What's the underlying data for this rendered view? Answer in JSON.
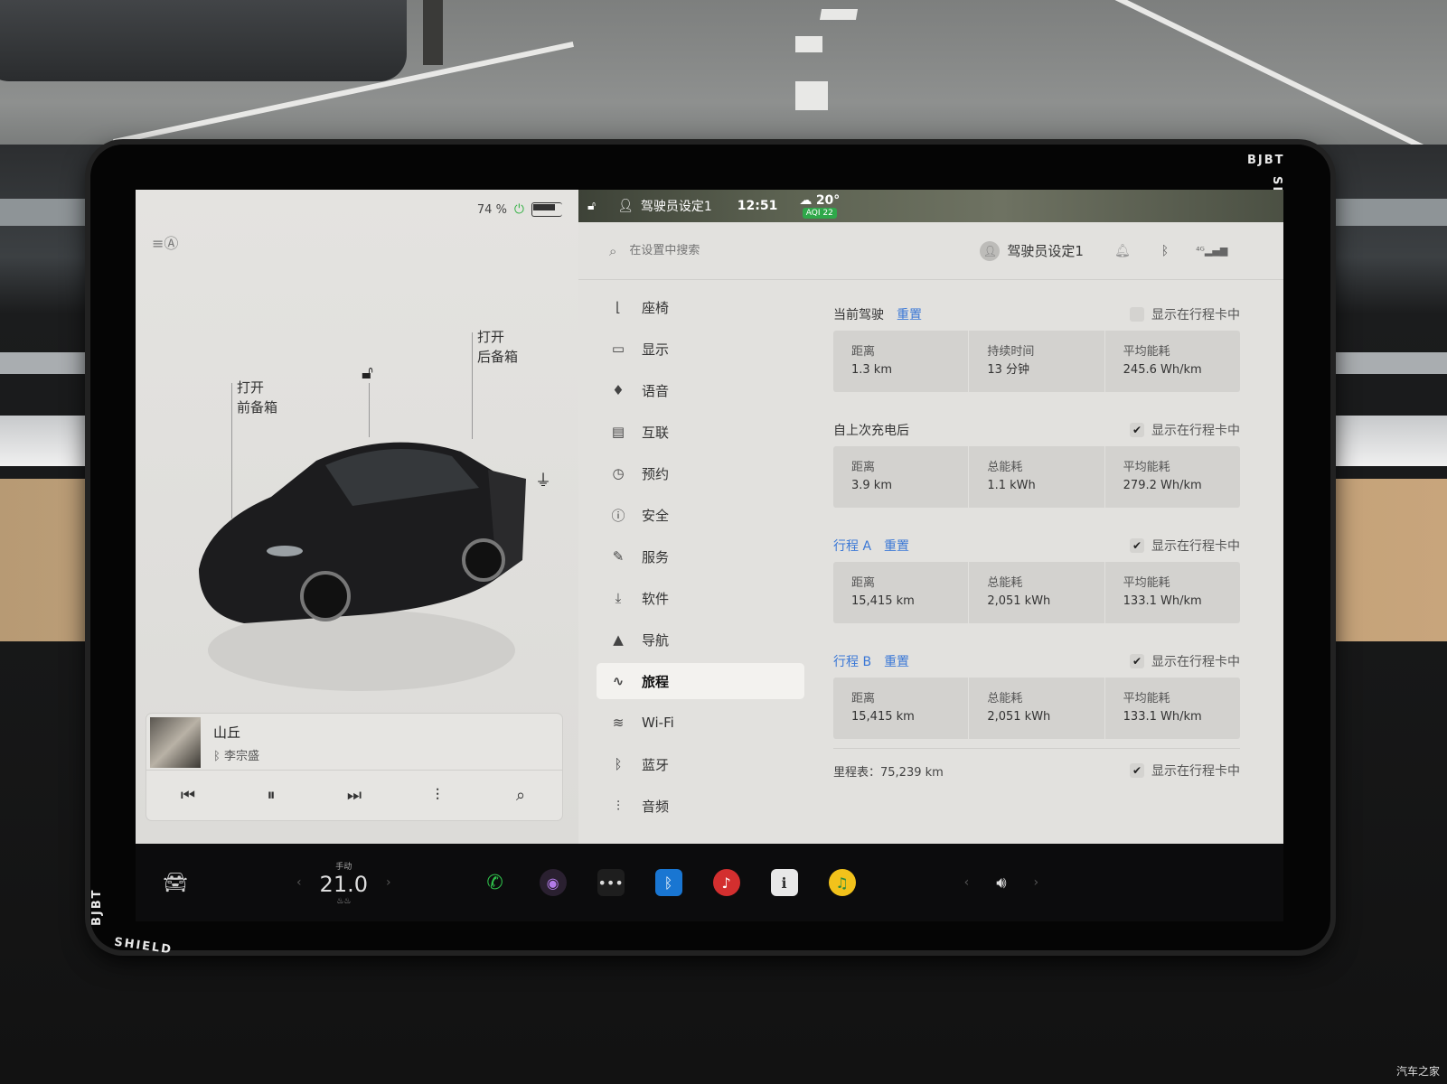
{
  "battery": {
    "percent": "74 %"
  },
  "car": {
    "frunk_label_1": "打开",
    "frunk_label_2": "前备箱",
    "trunk_label_1": "打开",
    "trunk_label_2": "后备箱"
  },
  "media": {
    "title": "山丘",
    "artist": "李宗盛"
  },
  "status": {
    "profile": "驾驶员设定1",
    "time": "12:51",
    "temperature": "20°",
    "aqi": "AQI 22"
  },
  "search": {
    "placeholder": "在设置中搜索"
  },
  "profile": {
    "name": "驾驶员设定1"
  },
  "menu": [
    {
      "icon": "seat-icon",
      "glyph": "⌊",
      "label": "座椅"
    },
    {
      "icon": "display-icon",
      "glyph": "▭",
      "label": "显示"
    },
    {
      "icon": "mic-icon",
      "glyph": "♦",
      "label": "语音"
    },
    {
      "icon": "connect-icon",
      "glyph": "▤",
      "label": "互联"
    },
    {
      "icon": "alarm-icon",
      "glyph": "◷",
      "label": "预约"
    },
    {
      "icon": "safety-icon",
      "glyph": "ⓘ",
      "label": "安全"
    },
    {
      "icon": "wrench-icon",
      "glyph": "✎",
      "label": "服务"
    },
    {
      "icon": "download-icon",
      "glyph": "⤓",
      "label": "软件"
    },
    {
      "icon": "navigate-icon",
      "glyph": "▲",
      "label": "导航"
    },
    {
      "icon": "trips-icon",
      "glyph": "∿",
      "label": "旅程"
    },
    {
      "icon": "wifi-icon",
      "glyph": "≋",
      "label": "Wi-Fi"
    },
    {
      "icon": "bluetooth-icon",
      "glyph": "ᛒ",
      "label": "蓝牙"
    },
    {
      "icon": "audio-icon",
      "glyph": "⫶",
      "label": "音频"
    }
  ],
  "trips": {
    "show_label": "显示在行程卡中",
    "reset_label": "重置",
    "current": {
      "title": "当前驾驶",
      "cells": [
        {
          "label": "距离",
          "value": "1.3 km"
        },
        {
          "label": "持续时间",
          "value": "13 分钟"
        },
        {
          "label": "平均能耗",
          "value": "245.6 Wh/km"
        }
      ]
    },
    "since_charge": {
      "title": "自上次充电后",
      "cells": [
        {
          "label": "距离",
          "value": "3.9 km"
        },
        {
          "label": "总能耗",
          "value": "1.1 kWh"
        },
        {
          "label": "平均能耗",
          "value": "279.2 Wh/km"
        }
      ]
    },
    "trip_a": {
      "title": "行程 A",
      "cells": [
        {
          "label": "距离",
          "value": "15,415 km"
        },
        {
          "label": "总能耗",
          "value": "2,051 kWh"
        },
        {
          "label": "平均能耗",
          "value": "133.1 Wh/km"
        }
      ]
    },
    "trip_b": {
      "title": "行程 B",
      "cells": [
        {
          "label": "距离",
          "value": "15,415 km"
        },
        {
          "label": "总能耗",
          "value": "2,051 kWh"
        },
        {
          "label": "平均能耗",
          "value": "133.1 Wh/km"
        }
      ]
    },
    "odometer": "里程表：75,239 km"
  },
  "dock": {
    "climate_mode": "手动",
    "temperature": "21.0"
  },
  "photo": {
    "bezel_brand": "BJBT",
    "bezel_name": "SHIELD",
    "watermark": "汽车之家"
  }
}
